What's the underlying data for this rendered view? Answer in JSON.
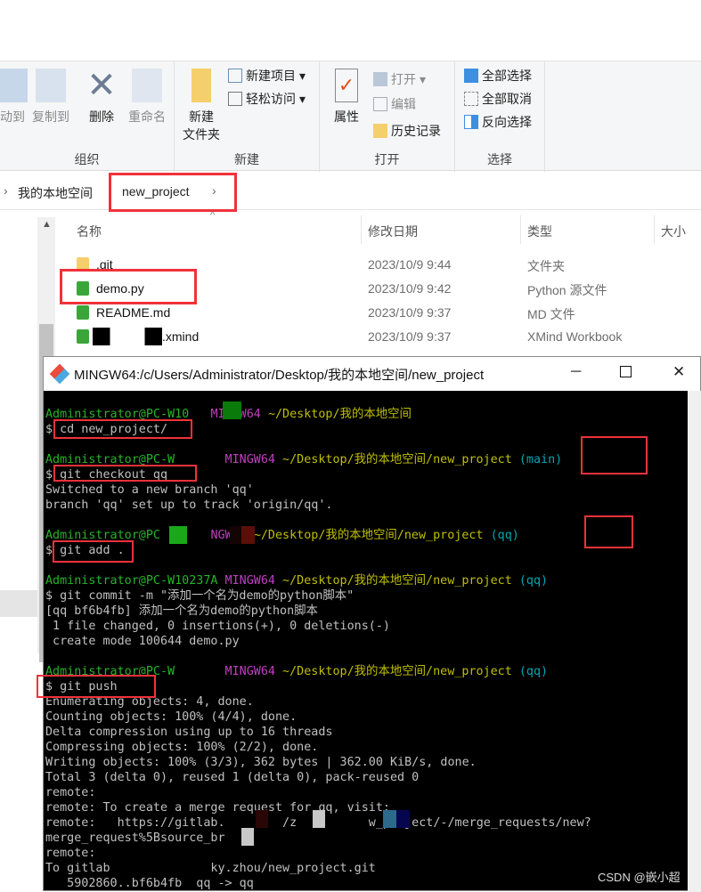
{
  "ribbon": {
    "groups": [
      {
        "label": "组织",
        "items": [
          "动到",
          "复制到",
          "删除",
          "重命名"
        ]
      },
      {
        "label": "新建",
        "items": [
          "新建\n文件夹",
          "新建项目",
          "轻松访问"
        ]
      },
      {
        "label": "打开",
        "items": [
          "属性",
          "打开",
          "编辑",
          "历史记录"
        ]
      },
      {
        "label": "选择",
        "items": [
          "全部选择",
          "全部取消",
          "反向选择"
        ]
      }
    ]
  },
  "address": {
    "crumbs": [
      "我的本地空间",
      "new_project"
    ]
  },
  "columns": [
    "名称",
    "修改日期",
    "类型",
    "大小"
  ],
  "files": [
    {
      "name": ".git",
      "date": "2023/10/9 9:44",
      "type": "文件夹",
      "icon": "folder-icon"
    },
    {
      "name": "demo.py",
      "date": "2023/10/9 9:42",
      "type": "Python 源文件",
      "icon": "python-file-icon"
    },
    {
      "name": "README.md",
      "date": "2023/10/9 9:37",
      "type": "MD 文件",
      "icon": "markdown-file-icon"
    },
    {
      "name": ".xmind",
      "date": "2023/10/9 9:37",
      "type": "XMind Workbook",
      "icon": "xmind-file-icon"
    }
  ],
  "terminal": {
    "title": "MINGW64:/c/Users/Administrator/Desktop/我的本地空间/new_project",
    "colors": {
      "user": "#27b427",
      "host": "#bf40bf",
      "path": "#bfbf00",
      "branch": "#00a6b2",
      "text": "#c0c0c0"
    },
    "lines": [
      [
        [
          "Administrator@PC-W10   ",
          "user"
        ],
        [
          "MINGW64 ",
          "host"
        ],
        [
          "~/Desktop/我的本地空间",
          "path"
        ]
      ],
      [
        [
          "$ cd new_project/",
          "text"
        ]
      ],
      [],
      [
        [
          "Administrator@PC-W       ",
          "user"
        ],
        [
          "MINGW64 ",
          "host"
        ],
        [
          "~/Desktop/我的本地空间/new_project",
          "path"
        ],
        [
          " (main)",
          "branch"
        ]
      ],
      [
        [
          "$ git checkout qq",
          "text"
        ]
      ],
      [
        [
          "Switched to a new branch 'qq'",
          "text"
        ]
      ],
      [
        [
          "branch 'qq' set up to track 'origin/qq'.",
          "text"
        ]
      ],
      [],
      [
        [
          "Administrator@PC       ",
          "user"
        ],
        [
          "NGW64 ",
          "host"
        ],
        [
          "~/Desktop/我的本地空间/new_project",
          "path"
        ],
        [
          " (qq)",
          "branch"
        ]
      ],
      [
        [
          "$ git add .",
          "text"
        ]
      ],
      [],
      [
        [
          "Administrator@PC-W10237A ",
          "user"
        ],
        [
          "MINGW64 ",
          "host"
        ],
        [
          "~/Desktop/我的本地空间/new_project",
          "path"
        ],
        [
          " (qq)",
          "branch"
        ]
      ],
      [
        [
          "$ git commit -m \"添加一个名为demo的python脚本\"",
          "text"
        ]
      ],
      [
        [
          "[qq bf6b4fb] 添加一个名为demo的python脚本",
          "text"
        ]
      ],
      [
        [
          " 1 file changed, 0 insertions(+), 0 deletions(-)",
          "text"
        ]
      ],
      [
        [
          " create mode 100644 demo.py",
          "text"
        ]
      ],
      [],
      [
        [
          "Administrator@PC-W       ",
          "user"
        ],
        [
          "MINGW64 ",
          "host"
        ],
        [
          "~/Desktop/我的本地空间/new_project",
          "path"
        ],
        [
          " (qq)",
          "branch"
        ]
      ],
      [
        [
          "$ git push",
          "text"
        ]
      ],
      [
        [
          "Enumerating objects: 4, done.",
          "text"
        ]
      ],
      [
        [
          "Counting objects: 100% (4/4), done.",
          "text"
        ]
      ],
      [
        [
          "Delta compression using up to 16 threads",
          "text"
        ]
      ],
      [
        [
          "Compressing objects: 100% (2/2), done.",
          "text"
        ]
      ],
      [
        [
          "Writing objects: 100% (3/3), 362 bytes | 362.00 KiB/s, done.",
          "text"
        ]
      ],
      [
        [
          "Total 3 (delta 0), reused 1 (delta 0), pack-reused 0",
          "text"
        ]
      ],
      [
        [
          "remote:",
          "text"
        ]
      ],
      [
        [
          "remote: To create a merge request for qq, visit:",
          "text"
        ]
      ],
      [
        [
          "remote:   https://gitlab.        /z          w_project/-/merge_requests/new?",
          "text"
        ]
      ],
      [
        [
          "merge_request%5Bsource_br",
          "text"
        ]
      ],
      [
        [
          "remote:",
          "text"
        ]
      ],
      [
        [
          "To gitlab              ky.zhou/new_project.git",
          "text"
        ]
      ],
      [
        [
          "   5902860..bf6b4fb  qq -> qq",
          "text"
        ]
      ]
    ]
  },
  "watermark": "CSDN @嵌小超",
  "accent": "#f0323a"
}
